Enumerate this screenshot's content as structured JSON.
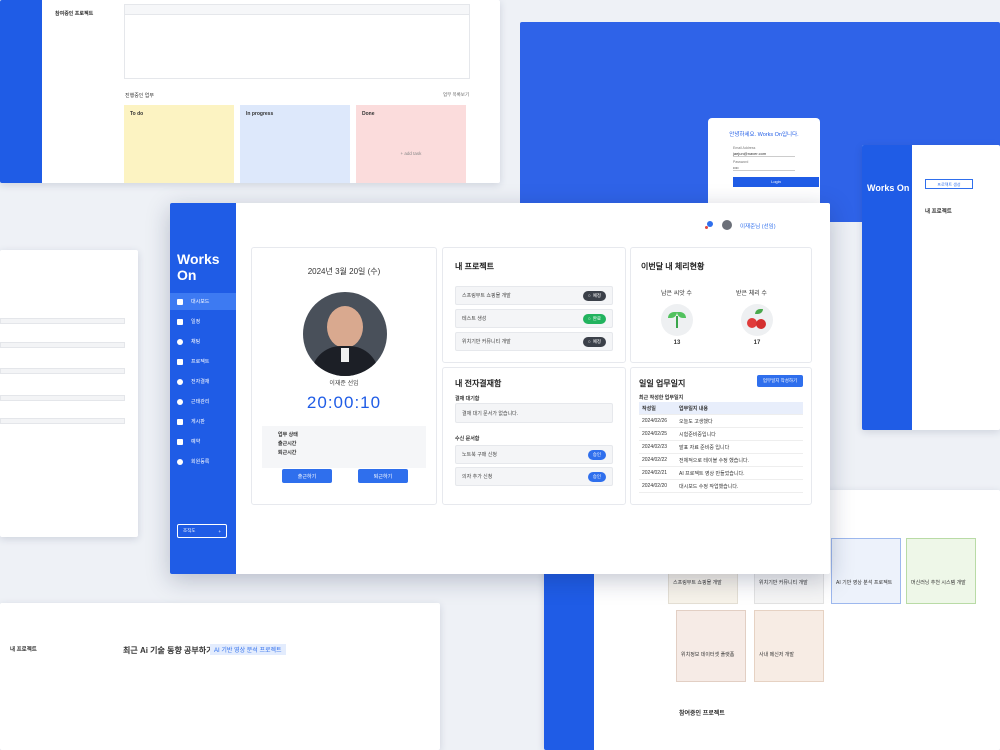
{
  "main": {
    "logo": "Works On",
    "nav": [
      "대시보드",
      "일정",
      "채팅",
      "프로젝트",
      "전자결재",
      "근태관리",
      "게시판",
      "예약",
      "회원등록"
    ],
    "org_button": "조직도",
    "user_name": "이재준님 (선임)",
    "date": "2024년 3월 20일 (수)",
    "employee": "이재준 선임",
    "clock": "20:00:10",
    "status_labels": [
      "업무 상태",
      "출근시간",
      "퇴근시간"
    ],
    "checkin": "출근하기",
    "checkout": "퇴근하기",
    "projects_title": "내 프로젝트",
    "projects": [
      {
        "name": "스프링부트 쇼핑몰 개발",
        "status": "예정",
        "color": "dark"
      },
      {
        "name": "테스트 생성",
        "status": "완료",
        "color": "green"
      },
      {
        "name": "위치기반 커뮤니티 개발",
        "status": "예정",
        "color": "dark"
      }
    ],
    "health_title": "이번달 내 체리현황",
    "seeds_label": "남은 씨앗 수",
    "seeds": "13",
    "cherry_label": "받은 체리 수",
    "cherries": "17",
    "approval_title": "내 전자결재함",
    "wait_label": "결재 대기함",
    "wait_empty": "결재 대기 문서가 없습니다.",
    "recv_label": "수신 문서함",
    "recv": [
      {
        "name": "노트북 구매 신청",
        "status": "승인"
      },
      {
        "name": "의자 추가 신청",
        "status": "승인"
      }
    ],
    "log_title": "일일 업무일지",
    "log_button": "업무일지 작성하기",
    "log_sub": "최근 작성한 업무일지",
    "log_headers": [
      "작성일",
      "업무일지 내용"
    ],
    "logs": [
      [
        "2024/02/26",
        "오늘도 고생했다"
      ],
      [
        "2024/02/25",
        "시험준비중입니다"
      ],
      [
        "2024/02/23",
        "발표 자료 준비중 입니다"
      ],
      [
        "2024/02/22",
        "전체적으로 테이블 수정 했습니다."
      ],
      [
        "2024/02/21",
        "AI 프로젝트 영상 만들었습니다."
      ],
      [
        "2024/02/20",
        "대시보드 수정 작업했습니다."
      ]
    ]
  },
  "bg": {
    "login_greet": "안녕하세요. Works On입니다.",
    "email_label": "Email Address",
    "email": "jaejun@naver.com",
    "pw_label": "Password",
    "pw": "••••",
    "login": "Login",
    "kanban": [
      "To do",
      "In progress",
      "Done"
    ],
    "add_task": "+ add task",
    "progress_title": "진행중인 업무",
    "more": "업무 목록보기",
    "joined": "참여중인 프로젝트",
    "detail_title": "최근 Ai 기술 동향 공부하기",
    "detail_tag": "AI 기반 영상 분석 프로젝트",
    "myproj": "내 프로젝트",
    "proj_create": "프로젝트 생성",
    "plist": [
      "스프링부트 쇼핑몰 개발",
      "위치기반 커뮤니티 개발",
      "AI 기반 영상 분석 프로젝트",
      "머신러닝 추천 시스템 개발",
      "위치정보 데이터셋 플랫폼"
    ],
    "cards": [
      "스프링부트 쇼핑몰 개발",
      "위치기반 커뮤니티 개발",
      "AI 기반 영상 분석 프로젝트",
      "머신러닝 추천 시스템 개발",
      "위치정보 데이터셋 플랫폼",
      "사내 메신저 개발"
    ],
    "joined2": "참여중인 프로젝트"
  }
}
